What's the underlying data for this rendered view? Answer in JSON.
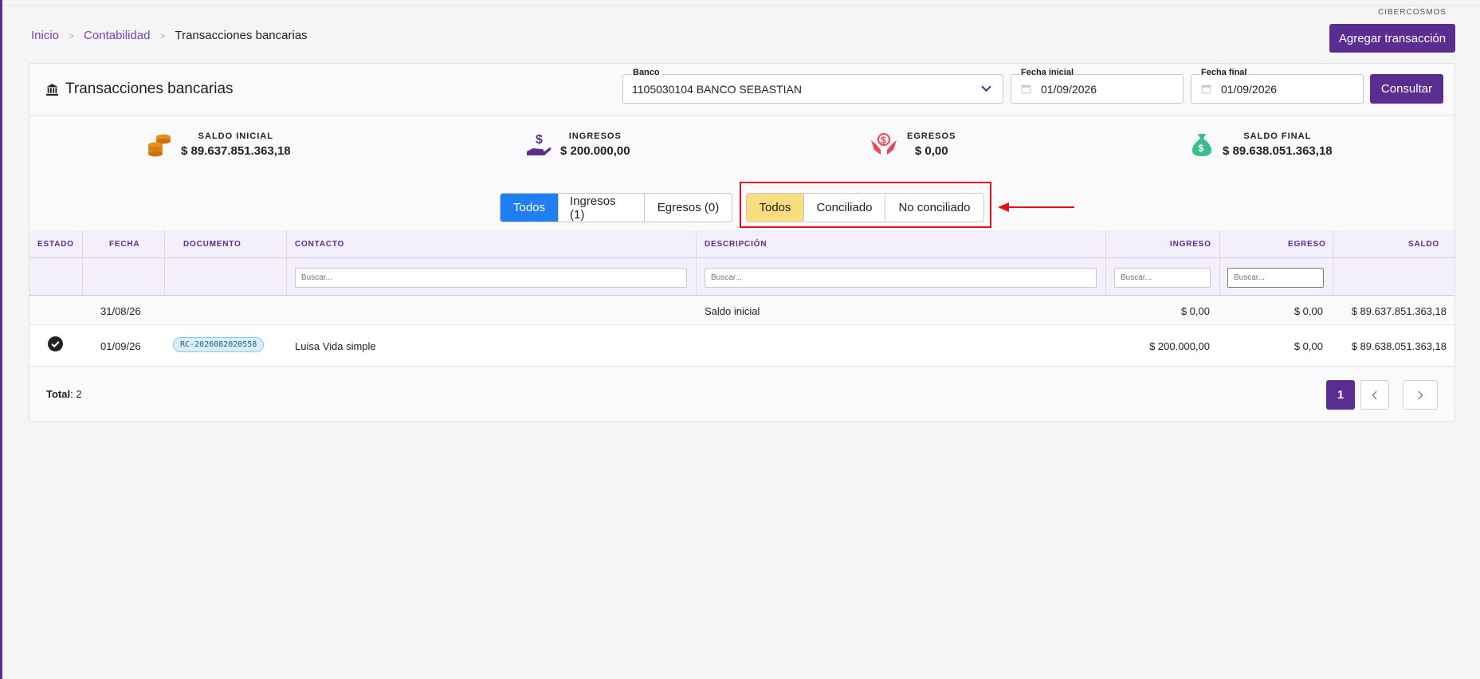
{
  "brand": "CIBERCOSMOS",
  "breadcrumb": {
    "home": "Inicio",
    "section": "Contabilidad",
    "current": "Transacciones bancarias"
  },
  "actions": {
    "add_transaction": "Agregar transacción",
    "consult": "Consultar"
  },
  "header": {
    "title": "Transacciones bancarias",
    "bank_label": "Banco",
    "bank_value": "1105030104 BANCO SEBASTIAN",
    "start_label": "Fecha inicial",
    "start_value": "01/09/2026",
    "end_label": "Fecha final",
    "end_value": "01/09/2026"
  },
  "stats": {
    "initial": {
      "label": "SALDO INICIAL",
      "amount": "$ 89.637.851.363,18"
    },
    "income": {
      "label": "INGRESOS",
      "amount": "$ 200.000,00"
    },
    "expense": {
      "label": "EGRESOS",
      "amount": "$ 0,00"
    },
    "final": {
      "label": "SALDO FINAL",
      "amount": "$ 89.638.051.363,18"
    }
  },
  "type_filter": {
    "all": "Todos",
    "income": "Ingresos (1)",
    "expense": "Egresos (0)",
    "active": "all"
  },
  "reconcile_filter": {
    "all": "Todos",
    "reconciled": "Conciliado",
    "not_reconciled": "No conciliado",
    "active": "all"
  },
  "table": {
    "columns": {
      "estado": "ESTADO",
      "fecha": "FECHA",
      "documento": "DOCUMENTO",
      "contacto": "CONTACTO",
      "descripcion": "DESCRIPCIÓN",
      "ingreso": "INGRESO",
      "egreso": "EGRESO",
      "saldo": "SALDO"
    },
    "search_placeholder": "Buscar...",
    "rows": [
      {
        "fecha": "31/08/26",
        "documento": "",
        "contacto": "",
        "descripcion": "Saldo inicial",
        "ingreso": "$ 0,00",
        "egreso": "$ 0,00",
        "saldo": "$ 89.637.851.363,18",
        "estado": ""
      },
      {
        "fecha": "01/09/26",
        "documento": "RC-2026082020558",
        "contacto": "Luisa Vida simple",
        "descripcion": "",
        "ingreso": "$ 200.000,00",
        "egreso": "$ 0,00",
        "saldo": "$ 89.638.051.363,18",
        "estado": "check-circle-icon"
      }
    ]
  },
  "footer": {
    "total_label": "Total",
    "total_value": ": 2",
    "page": "1"
  },
  "colors": {
    "primary": "#5a2d91",
    "blue": "#1f7ef0",
    "yellow": "#fbdc80",
    "highlight": "#e0101a"
  }
}
